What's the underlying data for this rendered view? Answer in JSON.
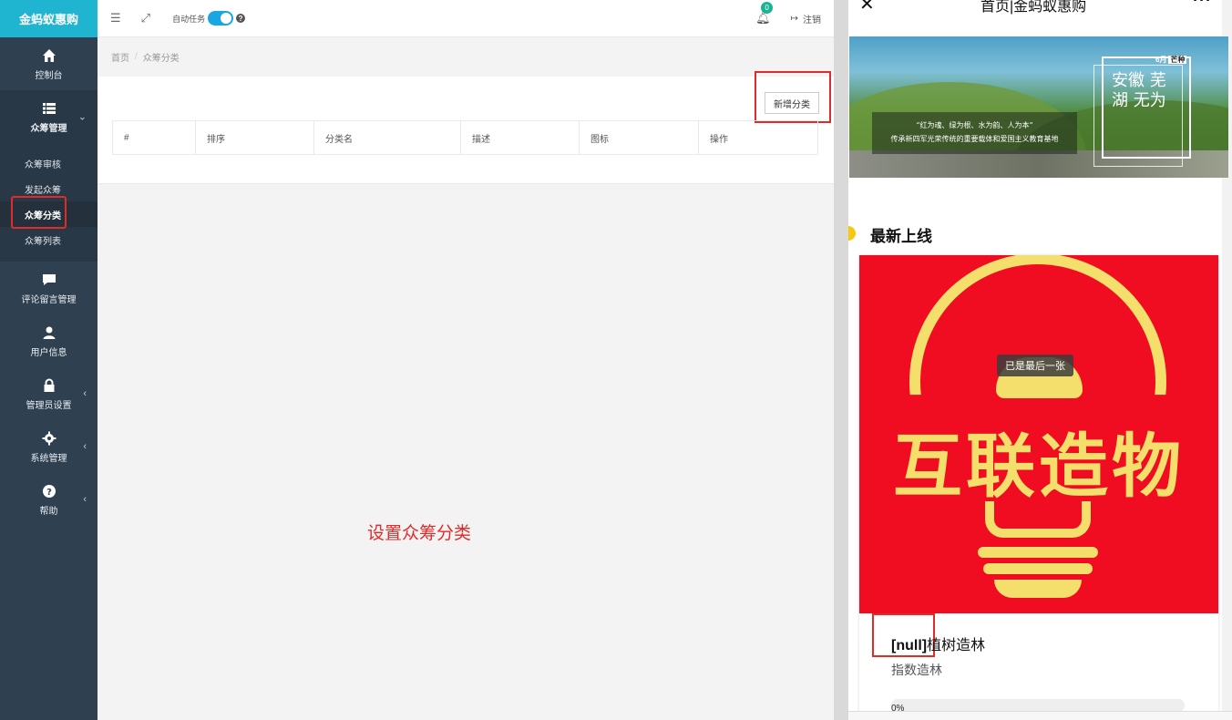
{
  "app": {
    "brand": "金蚂蚁惠购"
  },
  "sidebar": {
    "items": [
      {
        "label": "控制台",
        "icon": "home-icon"
      },
      {
        "label": "众筹管理",
        "icon": "list-icon"
      },
      {
        "label": "评论留言管理",
        "icon": "comment-icon"
      },
      {
        "label": "用户信息",
        "icon": "user-icon"
      },
      {
        "label": "管理员设置",
        "icon": "lock-icon"
      },
      {
        "label": "系统管理",
        "icon": "gear-icon"
      },
      {
        "label": "帮助",
        "icon": "help-icon"
      }
    ],
    "sub_items": [
      {
        "label": "众筹审核"
      },
      {
        "label": "发起众筹"
      },
      {
        "label": "众筹分类"
      },
      {
        "label": "众筹列表"
      }
    ]
  },
  "topbar": {
    "auto_task_label": "自动任务",
    "auto_task_on": true,
    "notification_count": "0",
    "logout_label": "注销"
  },
  "breadcrumb": {
    "home": "首页",
    "current": "众筹分类"
  },
  "toolbar": {
    "add_label": "新增分类"
  },
  "table": {
    "headers": [
      "#",
      "排序",
      "分类名",
      "描述",
      "图标",
      "操作"
    ]
  },
  "annotation": "设置众筹分类",
  "mobile": {
    "title": "首页|金蚂蚁惠购",
    "banner": {
      "slogan_line1": "“红为魂、绿为根、水为韵、人为本”",
      "slogan_line2": "传承新四军光荣传统的重要载体和爱国主义教育基地",
      "city": "安徽 芜湖 无为",
      "tag_month": "6月",
      "tag_term": "芒种"
    },
    "section_title": "最新上线",
    "card": {
      "image_text": "互联造物",
      "toast": "已是最后一张",
      "title_prefix": "[null]",
      "title": "植树造林",
      "subtitle": "指数造林",
      "progress_label": "0%",
      "progress": 0
    }
  },
  "colors": {
    "brand": "#1fb5d1",
    "sidebar": "#2f4050",
    "highlight": "#e12b2b",
    "card_bg": "#f00d22",
    "logo_yellow": "#f4de6c"
  }
}
